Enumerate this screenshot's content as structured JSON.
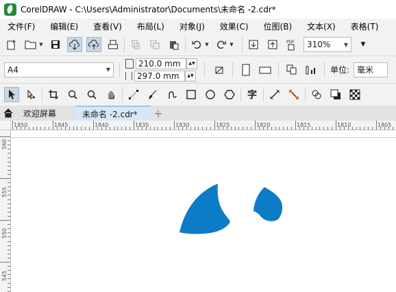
{
  "window": {
    "title": "CorelDRAW - C:\\Users\\Administrator\\Documents\\未命名 -2.cdr*"
  },
  "menu": {
    "items": [
      "文件(F)",
      "编辑(E)",
      "查看(V)",
      "布局(L)",
      "对象(J)",
      "效果(C)",
      "位图(B)",
      "文本(X)",
      "表格(T)"
    ]
  },
  "standard_toolbar": {
    "zoom_level": "310%"
  },
  "property_bar": {
    "page_size": "A4",
    "width": "210.0 mm",
    "height": "297.0 mm",
    "units_label": "单位:",
    "units_value": "毫米"
  },
  "toolbox": {
    "text_tool_glyph": "字"
  },
  "tabs": {
    "welcome": "欢迎屏幕",
    "document": "未命名 -2.cdr*",
    "add_symbol": "+"
  },
  "rulers": {
    "horizontal_labels": [
      "1850",
      "1845",
      "1840",
      "1835",
      "1830",
      "1825",
      "1820",
      "1815",
      "1810",
      "1805"
    ],
    "vertical_labels": [
      "560",
      "555",
      "550",
      "545"
    ]
  },
  "colors": {
    "shape_fill": "#0c7cc8",
    "accent_green": "#1f8c3a",
    "active_tab": "#d6e7f7"
  },
  "icons": [
    "app-logo-icon",
    "new-document-icon",
    "open-folder-icon",
    "save-icon",
    "cloud-download-icon",
    "cloud-upload-icon",
    "print-icon",
    "cut-icon",
    "copy-icon",
    "paste-icon",
    "undo-icon",
    "redo-icon",
    "import-icon",
    "export-icon",
    "pdf-icon",
    "portrait-icon",
    "landscape-icon",
    "all-pages-icon",
    "current-page-icon",
    "pick-tool-icon",
    "shape-tool-icon",
    "crop-tool-icon",
    "zoom-tool-icon",
    "pan-tool-icon",
    "curve-tool-icon",
    "artistic-media-icon",
    "pen-tool-icon",
    "rectangle-tool-icon",
    "ellipse-tool-icon",
    "polygon-tool-icon",
    "text-tool-icon",
    "parallel-dimension-icon",
    "connector-tool-icon",
    "transparency-tool-icon",
    "drop-shadow-icon",
    "checker-icon",
    "home-icon"
  ]
}
